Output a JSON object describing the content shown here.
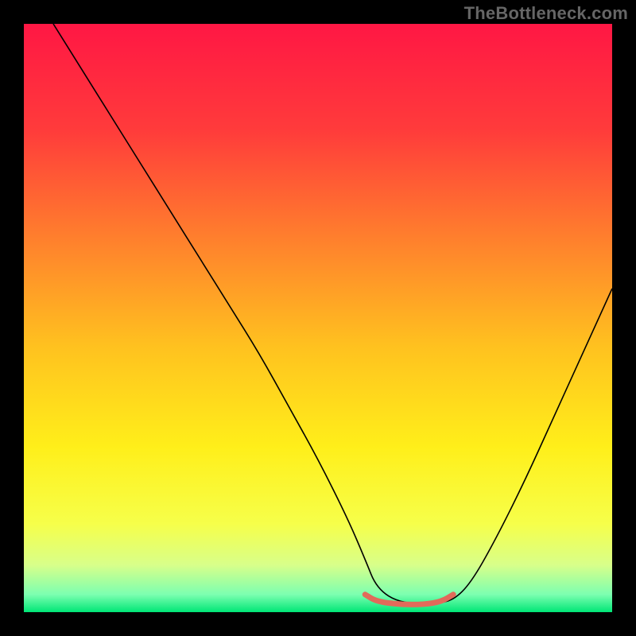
{
  "attribution": "TheBottleneck.com",
  "chart_data": {
    "type": "line",
    "title": "",
    "xlabel": "",
    "ylabel": "",
    "xlim": [
      0,
      100
    ],
    "ylim": [
      0,
      100
    ],
    "legend": false,
    "grid": false,
    "background_gradient": {
      "stops": [
        {
          "pos": 0.0,
          "color": "#ff1744"
        },
        {
          "pos": 0.18,
          "color": "#ff3b3b"
        },
        {
          "pos": 0.35,
          "color": "#ff7a2e"
        },
        {
          "pos": 0.55,
          "color": "#ffc21f"
        },
        {
          "pos": 0.72,
          "color": "#ffef1a"
        },
        {
          "pos": 0.85,
          "color": "#f6ff4a"
        },
        {
          "pos": 0.92,
          "color": "#d8ff8a"
        },
        {
          "pos": 0.97,
          "color": "#7cffb0"
        },
        {
          "pos": 1.0,
          "color": "#00e676"
        }
      ]
    },
    "series": [
      {
        "name": "bottleneck-curve",
        "stroke": "#000000",
        "stroke_width": 1.6,
        "x": [
          5,
          10,
          15,
          20,
          25,
          30,
          35,
          40,
          45,
          50,
          55,
          58,
          60,
          64,
          70,
          73,
          76,
          80,
          85,
          90,
          95,
          100
        ],
        "y": [
          100,
          92,
          84,
          76,
          68,
          60,
          52,
          44,
          35,
          26,
          16,
          9,
          4,
          1.5,
          1.5,
          2,
          5,
          12,
          22,
          33,
          44,
          55
        ]
      },
      {
        "name": "optimal-range-marker",
        "stroke": "#e26a5a",
        "stroke_width": 7,
        "linecap": "round",
        "x": [
          58,
          60,
          64,
          68,
          71,
          73
        ],
        "y": [
          3.0,
          1.8,
          1.3,
          1.3,
          1.8,
          3.0
        ]
      }
    ],
    "annotations": []
  }
}
